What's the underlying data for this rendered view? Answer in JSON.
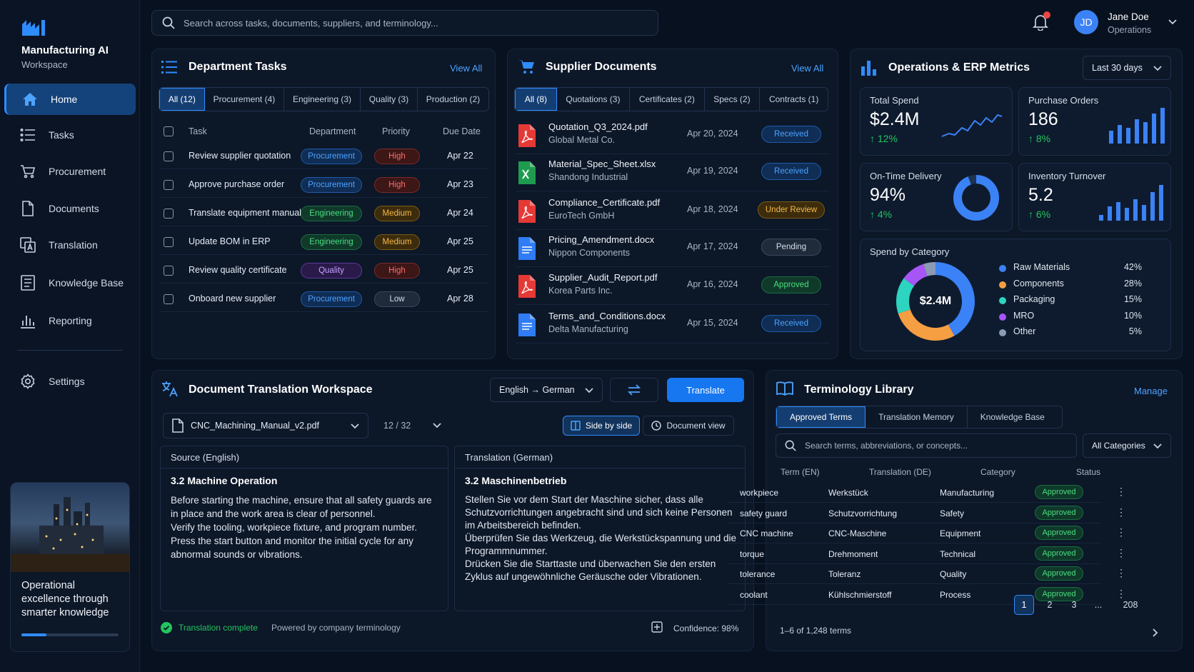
{
  "sidebar": {
    "brand_title": "Manufacturing AI",
    "brand_sub": "Workspace",
    "items": [
      {
        "label": "Home",
        "icon": "home-icon"
      },
      {
        "label": "Tasks",
        "icon": "list-icon"
      },
      {
        "label": "Procurement",
        "icon": "cart-icon"
      },
      {
        "label": "Documents",
        "icon": "document-icon"
      },
      {
        "label": "Translation",
        "icon": "translate-icon"
      },
      {
        "label": "Knowledge Base",
        "icon": "book-icon"
      },
      {
        "label": "Reporting",
        "icon": "bar-chart-icon"
      }
    ],
    "settings_label": "Settings",
    "promo_text": "Operational excellence through smarter knowledge",
    "promo_progress": 0.26
  },
  "header": {
    "search_placeholder": "Search across tasks, documents, suppliers, and terminology...",
    "user_initials": "JD",
    "user_name": "Jane Doe",
    "user_role": "Operations"
  },
  "tasks": {
    "title": "Department Tasks",
    "view_all": "View All",
    "tabs": [
      "All (12)",
      "Procurement (4)",
      "Engineering (3)",
      "Quality (3)",
      "Production (2)"
    ],
    "columns": [
      "Task",
      "Department",
      "Priority",
      "Due Date"
    ],
    "rows": [
      {
        "task": "Review supplier quotation",
        "dept": "Procurement",
        "priority": "High",
        "due": "Apr 22"
      },
      {
        "task": "Approve purchase order",
        "dept": "Procurement",
        "priority": "High",
        "due": "Apr 23"
      },
      {
        "task": "Translate equipment manual",
        "dept": "Engineering",
        "priority": "Medium",
        "due": "Apr 24"
      },
      {
        "task": "Update BOM in ERP",
        "dept": "Engineering",
        "priority": "Medium",
        "due": "Apr 25"
      },
      {
        "task": "Review quality certificate",
        "dept": "Quality",
        "priority": "High",
        "due": "Apr 25"
      },
      {
        "task": "Onboard new supplier",
        "dept": "Procurement",
        "priority": "Low",
        "due": "Apr 28"
      }
    ]
  },
  "suppliers": {
    "title": "Supplier Documents",
    "view_all": "View All",
    "tabs": [
      "All (8)",
      "Quotations (3)",
      "Certificates (2)",
      "Specs (2)",
      "Contracts (1)"
    ],
    "docs": [
      {
        "name": "Quotation_Q3_2024.pdf",
        "supplier": "Global Metal Co.",
        "date": "Apr 20, 2024",
        "status": "Received",
        "type": "pdf"
      },
      {
        "name": "Material_Spec_Sheet.xlsx",
        "supplier": "Shandong Industrial",
        "date": "Apr 19, 2024",
        "status": "Received",
        "type": "xlsx"
      },
      {
        "name": "Compliance_Certificate.pdf",
        "supplier": "EuroTech GmbH",
        "date": "Apr 18, 2024",
        "status": "Under Review",
        "type": "pdf"
      },
      {
        "name": "Pricing_Amendment.docx",
        "supplier": "Nippon Components",
        "date": "Apr 17, 2024",
        "status": "Pending",
        "type": "docx"
      },
      {
        "name": "Supplier_Audit_Report.pdf",
        "supplier": "Korea Parts Inc.",
        "date": "Apr 16, 2024",
        "status": "Approved",
        "type": "pdf"
      },
      {
        "name": "Terms_and_Conditions.docx",
        "supplier": "Delta Manufacturing",
        "date": "Apr 15, 2024",
        "status": "Received",
        "type": "docx"
      }
    ]
  },
  "metrics": {
    "title": "Operations & ERP Metrics",
    "range": "Last 30 days",
    "cards": [
      {
        "label": "Total Spend",
        "value": "$2.4M",
        "delta": "↑ 12%"
      },
      {
        "label": "Purchase Orders",
        "value": "186",
        "delta": "↑ 8%"
      },
      {
        "label": "On-Time Delivery",
        "value": "94%",
        "delta": "↑ 4%"
      },
      {
        "label": "Inventory Turnover",
        "value": "5.2",
        "delta": "↑ 6%"
      }
    ],
    "on_time_fraction": 0.94,
    "spend_title": "Spend by Category",
    "spend_center": "$2.4M",
    "categories": [
      {
        "name": "Raw Materials",
        "pct": "42%",
        "value": 42,
        "color": "#3b82f6"
      },
      {
        "name": "Components",
        "pct": "28%",
        "value": 28,
        "color": "#f59e42"
      },
      {
        "name": "Packaging",
        "pct": "15%",
        "value": 15,
        "color": "#2dd4bf"
      },
      {
        "name": "MRO",
        "pct": "10%",
        "value": 10,
        "color": "#a855f7"
      },
      {
        "name": "Other",
        "pct": "5%",
        "value": 5,
        "color": "#8b9bb4"
      }
    ]
  },
  "translation": {
    "title": "Document Translation Workspace",
    "lang": "English → German",
    "translate_btn": "Translate",
    "file": "CNC_Machining_Manual_v2.pdf",
    "pages": "12 / 32",
    "side_by_side": "Side by side",
    "document_view": "Document view",
    "source_head": "Source (English)",
    "source_title": "3.2 Machine Operation",
    "source_body": "Before starting the machine, ensure that all safety guards are in place and the work area is clear of personnel.\nVerify the tooling, workpiece fixture, and program number.\nPress the start button and monitor the initial cycle for any abnormal sounds or vibrations.",
    "target_head": "Translation (German)",
    "target_title": "3.2 Maschinenbetrieb",
    "target_body": "Stellen Sie vor dem Start der Maschine sicher, dass alle Schutzvorrichtungen angebracht sind und sich keine Personen im Arbeitsbereich befinden.\nÜberprüfen Sie das Werkzeug, die Werkstückspannung und die Programmnummer.\nDrücken Sie die Starttaste und überwachen Sie den ersten Zyklus auf ungewöhnliche Geräusche oder Vibrationen.",
    "status": "Translation complete",
    "powered": "Powered by company terminology",
    "confidence": "Confidence: 98%"
  },
  "terminology": {
    "title": "Terminology Library",
    "manage": "Manage",
    "tabs": [
      "Approved Terms",
      "Translation Memory",
      "Knowledge Base"
    ],
    "search_placeholder": "Search terms, abbreviations, or concepts...",
    "category_filter": "All Categories",
    "columns": [
      "Term (EN)",
      "Translation (DE)",
      "Category",
      "Status"
    ],
    "rows": [
      {
        "en": "workpiece",
        "de": "Werkstück",
        "cat": "Manufacturing",
        "status": "Approved"
      },
      {
        "en": "safety guard",
        "de": "Schutzvorrichtung",
        "cat": "Safety",
        "status": "Approved"
      },
      {
        "en": "CNC machine",
        "de": "CNC-Maschine",
        "cat": "Equipment",
        "status": "Approved"
      },
      {
        "en": "torque",
        "de": "Drehmoment",
        "cat": "Technical",
        "status": "Approved"
      },
      {
        "en": "tolerance",
        "de": "Toleranz",
        "cat": "Quality",
        "status": "Approved"
      },
      {
        "en": "coolant",
        "de": "Kühlschmierstoff",
        "cat": "Process",
        "status": "Approved"
      }
    ],
    "count_text": "1–6 of 1,248 terms",
    "pages": [
      "1",
      "2",
      "3",
      "...",
      "208"
    ]
  }
}
